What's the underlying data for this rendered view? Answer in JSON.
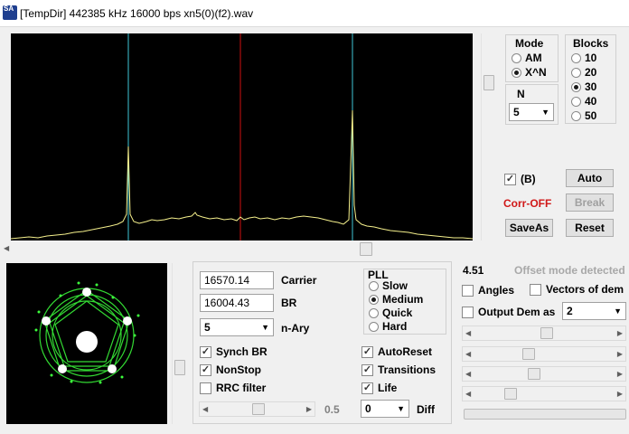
{
  "window": {
    "icon_text": "SA",
    "title": "[TempDir] 442385 kHz 16000 bps xn5(0)(f2).wav"
  },
  "mode": {
    "title": "Mode",
    "options": [
      {
        "label": "AM",
        "selected": false
      },
      {
        "label": "X^N",
        "selected": true
      }
    ]
  },
  "n": {
    "title": "N",
    "value": "5"
  },
  "blocks": {
    "title": "Blocks",
    "options": [
      {
        "label": "10",
        "selected": false
      },
      {
        "label": "20",
        "selected": false
      },
      {
        "label": "30",
        "selected": true
      },
      {
        "label": "40",
        "selected": false
      },
      {
        "label": "50",
        "selected": false
      }
    ]
  },
  "controls": {
    "b_label": "(B)",
    "b_checked": true,
    "auto_button": "Auto",
    "corr_status": "Corr-OFF",
    "break_button": "Break",
    "saveas_button": "SaveAs",
    "reset_button": "Reset"
  },
  "demod": {
    "carrier_value": "16570.14",
    "carrier_label": "Carrier",
    "br_value": "16004.43",
    "br_label": "BR",
    "nary_value": "5",
    "nary_label": "n-Ary",
    "synch_br": "Synch BR",
    "nonstop": "NonStop",
    "rrc_filter": "RRC filter",
    "slider_value": "0.5",
    "autoreset": "AutoReset",
    "transitions": "Transitions",
    "life": "Life",
    "diff_value": "0",
    "diff_label": "Diff"
  },
  "pll": {
    "title": "PLL",
    "options": [
      {
        "label": "Slow",
        "selected": false
      },
      {
        "label": "Medium",
        "selected": true
      },
      {
        "label": "Quick",
        "selected": false
      },
      {
        "label": "Hard",
        "selected": false
      }
    ]
  },
  "right": {
    "value": "4.51",
    "offset_status": "Offset mode detected",
    "angles": "Angles",
    "vectors": "Vectors of dem",
    "output_dem": "Output Dem as",
    "output_value": "2"
  },
  "colors": {
    "spectrum_trace": "#f5f08c",
    "marker_cyan": "#3fc6d6",
    "marker_red": "#d01010",
    "constellation": "#3cff3c",
    "corr_off": "#d01818"
  }
}
